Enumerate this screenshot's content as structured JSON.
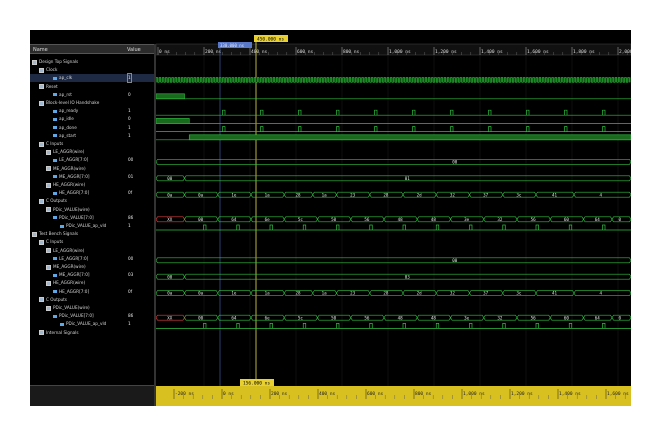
{
  "headers": {
    "name": "Name",
    "value": "Value"
  },
  "cursor": {
    "top_label": "450.000 ns",
    "marker_label": "330.000 ns",
    "bottom_label": "156.000 ns"
  },
  "timeline_top": [
    "0 ns",
    "200 ns",
    "400 ns",
    "600 ns",
    "800 ns",
    "1,000 ns",
    "1,200 ns",
    "1,400 ns",
    "1,600 ns",
    "1,800 ns",
    "2,000 ns"
  ],
  "timeline_bottom": [
    "-200 ns",
    "0 ns",
    "200 ns",
    "400 ns",
    "600 ns",
    "800 ns",
    "1,000 ns",
    "1,200 ns",
    "1,400 ns",
    "1,600 ns"
  ],
  "rows": [
    {
      "label": "Design Top Signals",
      "value": "",
      "indent": 0,
      "kind": "group"
    },
    {
      "label": "Clock",
      "value": "",
      "indent": 1,
      "kind": "group"
    },
    {
      "label": "ap_clk",
      "value": "1",
      "indent": 3,
      "kind": "signal",
      "selected": true
    },
    {
      "label": "Reset",
      "value": "",
      "indent": 1,
      "kind": "group"
    },
    {
      "label": "ap_rst",
      "value": "0",
      "indent": 3,
      "kind": "signal"
    },
    {
      "label": "Block-level IO Handshake",
      "value": "",
      "indent": 1,
      "kind": "group"
    },
    {
      "label": "ap_ready",
      "value": "1",
      "indent": 3,
      "kind": "signal"
    },
    {
      "label": "ap_idle",
      "value": "0",
      "indent": 3,
      "kind": "signal"
    },
    {
      "label": "ap_done",
      "value": "1",
      "indent": 3,
      "kind": "signal"
    },
    {
      "label": "ap_start",
      "value": "1",
      "indent": 3,
      "kind": "signal"
    },
    {
      "label": "C Inputs",
      "value": "",
      "indent": 1,
      "kind": "group"
    },
    {
      "label": "LE_AGGR(wire)",
      "value": "",
      "indent": 2,
      "kind": "group"
    },
    {
      "label": "LE_AGGR[7:0]",
      "value": "00",
      "indent": 3,
      "kind": "bus"
    },
    {
      "label": "ME_AGGR(wire)",
      "value": "",
      "indent": 2,
      "kind": "group"
    },
    {
      "label": "ME_AGGR[7:0]",
      "value": "01",
      "indent": 3,
      "kind": "bus"
    },
    {
      "label": "HE_AGGR(wire)",
      "value": "",
      "indent": 2,
      "kind": "group"
    },
    {
      "label": "HE_AGGR[7:0]",
      "value": "0f",
      "indent": 3,
      "kind": "bus"
    },
    {
      "label": "C Outputs",
      "value": "",
      "indent": 1,
      "kind": "group"
    },
    {
      "label": "PDic_VALUE(wire)",
      "value": "",
      "indent": 2,
      "kind": "group"
    },
    {
      "label": "PDic_VALUE[7:0]",
      "value": "86",
      "indent": 3,
      "kind": "bus"
    },
    {
      "label": "PDic_VALUE_ap_vld",
      "value": "1",
      "indent": 4,
      "kind": "signal"
    },
    {
      "label": "Test Bench Signals",
      "value": "",
      "indent": 0,
      "kind": "group"
    },
    {
      "label": "C Inputs",
      "value": "",
      "indent": 1,
      "kind": "group"
    },
    {
      "label": "LE_AGGR(wire)",
      "value": "",
      "indent": 2,
      "kind": "group"
    },
    {
      "label": "LE_AGGR[7:0]",
      "value": "00",
      "indent": 3,
      "kind": "bus"
    },
    {
      "label": "ME_AGGR(wire)",
      "value": "",
      "indent": 2,
      "kind": "group"
    },
    {
      "label": "ME_AGGR[7:0]",
      "value": "03",
      "indent": 3,
      "kind": "bus"
    },
    {
      "label": "HE_AGGR(wire)",
      "value": "",
      "indent": 2,
      "kind": "group"
    },
    {
      "label": "HE_AGGR[7:0]",
      "value": "0f",
      "indent": 3,
      "kind": "bus"
    },
    {
      "label": "C Outputs",
      "value": "",
      "indent": 1,
      "kind": "group"
    },
    {
      "label": "PDic_VALUE(wire)",
      "value": "",
      "indent": 2,
      "kind": "group"
    },
    {
      "label": "PDic_VALUE[7:0]",
      "value": "86",
      "indent": 3,
      "kind": "bus"
    },
    {
      "label": "PDic_VALUE_ap_vld",
      "value": "1",
      "indent": 4,
      "kind": "signal"
    },
    {
      "label": "Internal Signals",
      "value": "",
      "indent": 1,
      "kind": "group"
    }
  ],
  "waves": [
    {
      "row": 2,
      "type": "clock"
    },
    {
      "row": 4,
      "type": "pulse",
      "segments": [
        [
          0,
          0.06
        ]
      ]
    },
    {
      "row": 6,
      "type": "spikes",
      "at": [
        0.14,
        0.22,
        0.3,
        0.38,
        0.46,
        0.54,
        0.62,
        0.7,
        0.78,
        0.86,
        0.94
      ]
    },
    {
      "row": 7,
      "type": "pulse",
      "segments": [
        [
          0,
          0.07
        ]
      ]
    },
    {
      "row": 8,
      "type": "spikes",
      "at": [
        0.14,
        0.22,
        0.3,
        0.38,
        0.46,
        0.54,
        0.62,
        0.7,
        0.78,
        0.86,
        0.94
      ]
    },
    {
      "row": 9,
      "type": "pulse",
      "segments": [
        [
          0.07,
          1
        ]
      ]
    },
    {
      "row": 12,
      "type": "bus",
      "labels": [
        "00"
      ],
      "at": [
        0,
        1
      ],
      "center": 0.63
    },
    {
      "row": 14,
      "type": "bus",
      "labels": [
        "00",
        "01"
      ],
      "at": [
        0,
        0.06,
        1
      ]
    },
    {
      "row": 16,
      "type": "bus",
      "labels": [
        "0a",
        "0a",
        "1e",
        "1a",
        "28",
        "1a",
        "23",
        "28",
        "2d",
        "32",
        "37",
        "3c",
        "41",
        "4"
      ],
      "at": [
        0,
        0.06,
        0.13,
        0.2,
        0.27,
        0.33,
        0.38,
        0.45,
        0.52,
        0.59,
        0.66,
        0.73,
        0.8,
        0.88,
        1
      ]
    },
    {
      "row": 19,
      "type": "bus",
      "color": "#e04040",
      "labels": [
        "XX",
        "00",
        "64",
        "6e",
        "5c",
        "50",
        "56",
        "48",
        "48",
        "3e",
        "32",
        "56",
        "60",
        "64",
        "0"
      ],
      "at": [
        0,
        0.06,
        0.13,
        0.2,
        0.27,
        0.34,
        0.41,
        0.48,
        0.55,
        0.62,
        0.69,
        0.76,
        0.83,
        0.9,
        0.96,
        1
      ]
    },
    {
      "row": 20,
      "type": "spikes",
      "at": [
        0.1,
        0.17,
        0.24,
        0.31,
        0.38,
        0.45,
        0.52,
        0.59,
        0.66,
        0.73,
        0.8,
        0.87,
        0.94
      ]
    },
    {
      "row": 24,
      "type": "bus",
      "labels": [
        "00"
      ],
      "at": [
        0,
        1
      ],
      "center": 0.63
    },
    {
      "row": 26,
      "type": "bus",
      "labels": [
        "00",
        "03"
      ],
      "at": [
        0,
        0.06,
        1
      ]
    },
    {
      "row": 28,
      "type": "bus",
      "labels": [
        "0a",
        "0a",
        "1e",
        "1a",
        "28",
        "1a",
        "23",
        "28",
        "2d",
        "32",
        "37",
        "3c",
        "41",
        "4"
      ],
      "at": [
        0,
        0.06,
        0.13,
        0.2,
        0.27,
        0.33,
        0.38,
        0.45,
        0.52,
        0.59,
        0.66,
        0.73,
        0.8,
        0.88,
        1
      ]
    },
    {
      "row": 31,
      "type": "bus",
      "color": "#e04040",
      "labels": [
        "XX",
        "00",
        "64",
        "6e",
        "5c",
        "50",
        "56",
        "48",
        "48",
        "3e",
        "32",
        "56",
        "60",
        "64",
        "0"
      ],
      "at": [
        0,
        0.06,
        0.13,
        0.2,
        0.27,
        0.34,
        0.41,
        0.48,
        0.55,
        0.62,
        0.69,
        0.76,
        0.83,
        0.9,
        0.96,
        1
      ]
    },
    {
      "row": 32,
      "type": "spikes",
      "at": [
        0.1,
        0.17,
        0.24,
        0.31,
        0.38,
        0.45,
        0.52,
        0.59,
        0.66,
        0.73,
        0.8,
        0.87,
        0.94
      ]
    }
  ]
}
